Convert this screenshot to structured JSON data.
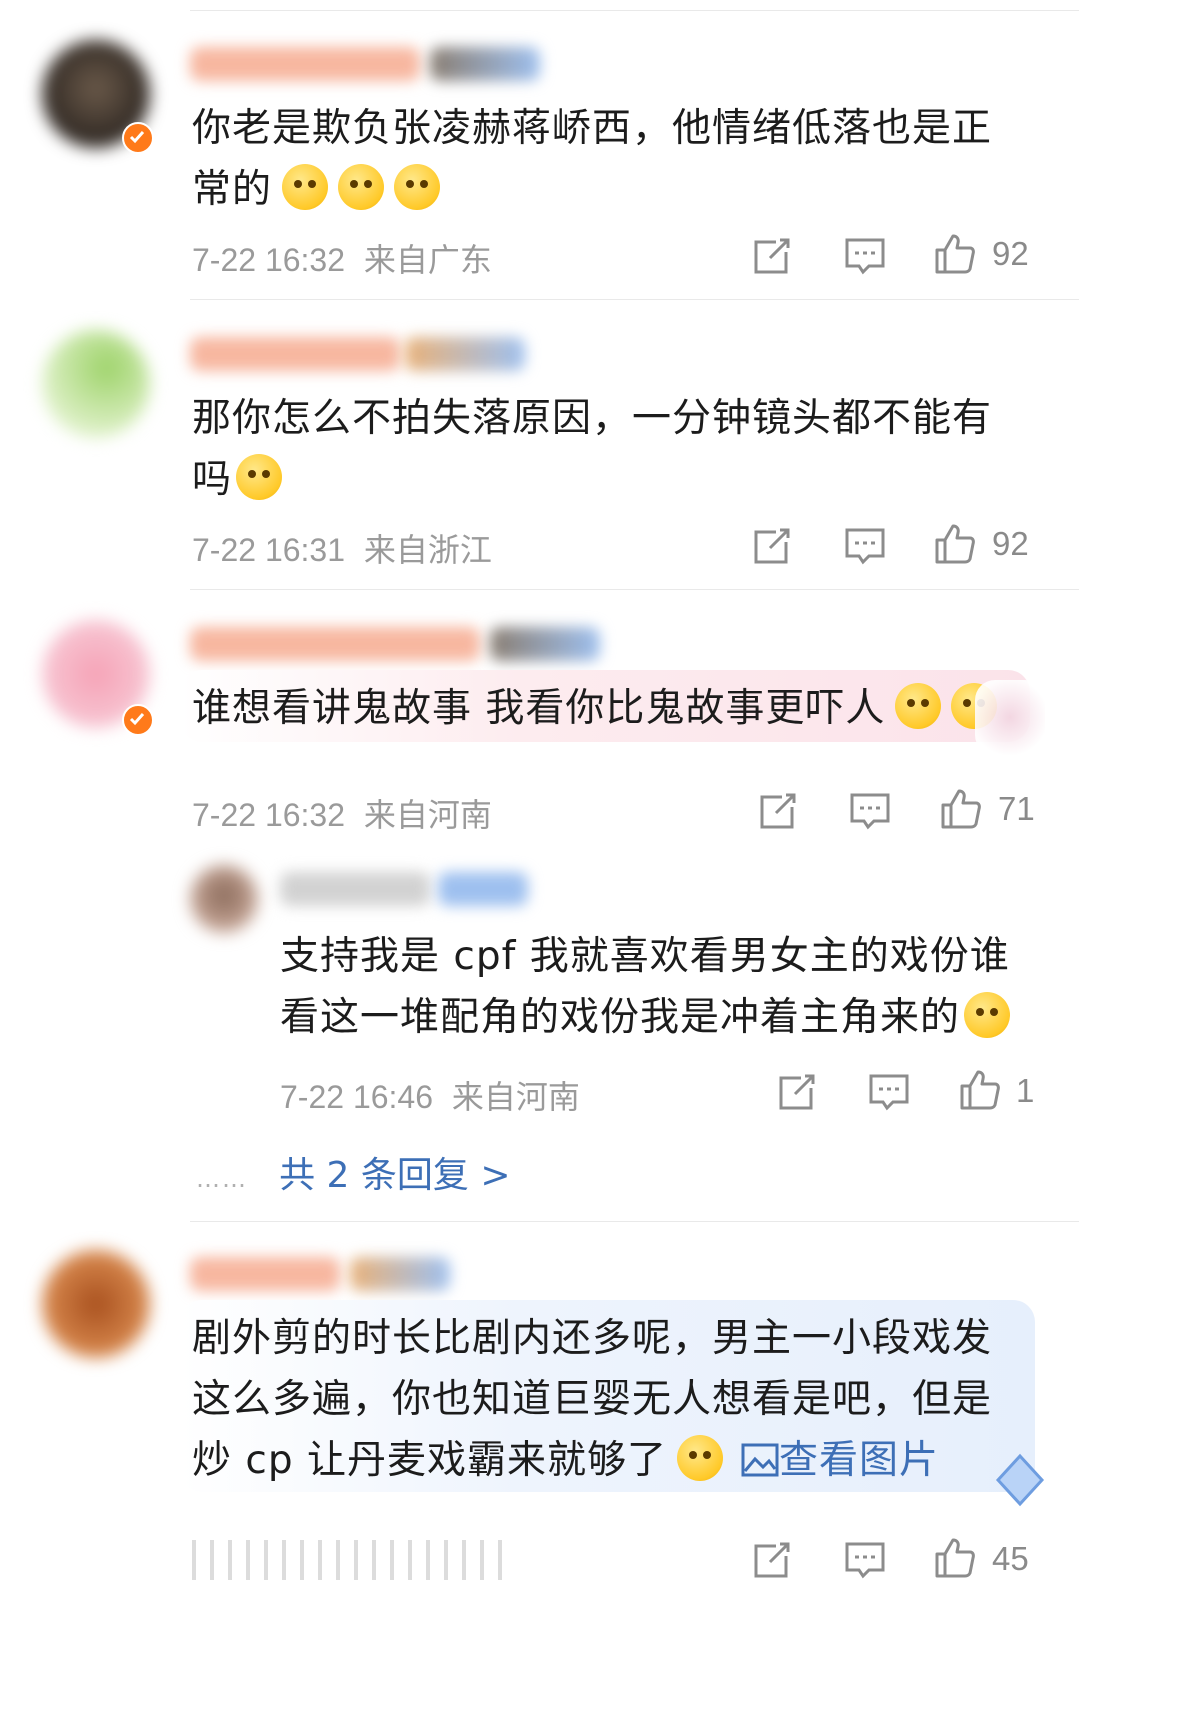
{
  "comments": [
    {
      "text_lines": [
        "你老是欺负张凌赫蒋峤西，他情绪低落也是正",
        "常的"
      ],
      "date": "7-22 16:32",
      "location": "来自广东",
      "likes": "92",
      "verified": true
    },
    {
      "text_lines": [
        "那你怎么不拍失落原因，一分钟镜头都不能有",
        "吗"
      ],
      "date": "7-22 16:31",
      "location": "来自浙江",
      "likes": "92",
      "verified": false
    },
    {
      "text_lines": [
        "谁想看讲鬼故事 我看你比鬼故事更吓人"
      ],
      "date": "7-22 16:32",
      "location": "来自河南",
      "likes": "71",
      "verified": true,
      "reply": {
        "text_lines": [
          "支持我是 cpf 我就喜欢看男女主的戏份谁",
          "看这一堆配角的戏份我是冲着主角来的"
        ],
        "date": "7-22 16:46",
        "location": "来自河南",
        "likes": "1"
      },
      "reply_summary": {
        "ellipsis": "……",
        "label": "共 2 条回复 >"
      }
    },
    {
      "text_lines": [
        "剧外剪的时长比剧内还多呢，男主一小段戏发",
        "这么多遍，你也知道巨婴无人想看是吧，但是",
        "炒 cp 让丹麦戏霸来就够了"
      ],
      "view_image": "查看图片",
      "likes": "45"
    }
  ],
  "icons": [
    "share-icon",
    "comment-icon",
    "like-icon",
    "image-icon",
    "verified-icon"
  ],
  "colors": {
    "link": "#3d6fb6",
    "verified": "#ff7a1a",
    "meta": "#9a9a9a"
  }
}
